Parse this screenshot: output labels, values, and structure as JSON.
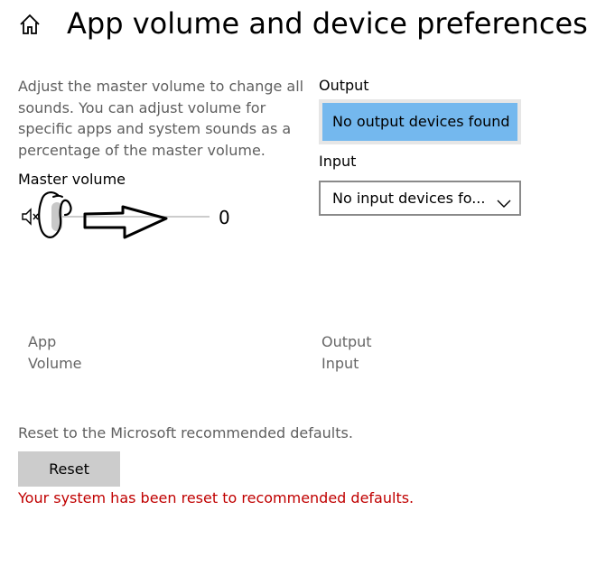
{
  "header": {
    "title": "App volume and device preferences",
    "home_icon": "home-icon"
  },
  "description": "Adjust the master volume to change all sounds. You can adjust volume for specific apps and system sounds as a percentage of the master volume.",
  "master_volume": {
    "label": "Master volume",
    "value": "0",
    "level": 0,
    "muted_icon": "speaker-muted-icon"
  },
  "output": {
    "label": "Output",
    "selected": "No output devices found"
  },
  "input": {
    "label": "Input",
    "selected": "No input devices fo..."
  },
  "table_headers": {
    "app_line1": "App",
    "app_line2": "Volume",
    "device_line1": "Output",
    "device_line2": "Input"
  },
  "reset": {
    "description": "Reset to the Microsoft recommended defaults.",
    "button_label": "Reset",
    "message": "Your system has been reset to recommended defaults.",
    "message_color": "#c00000"
  },
  "colors": {
    "accent_selected": "#74b8ee",
    "button_bg": "#cccccc"
  }
}
